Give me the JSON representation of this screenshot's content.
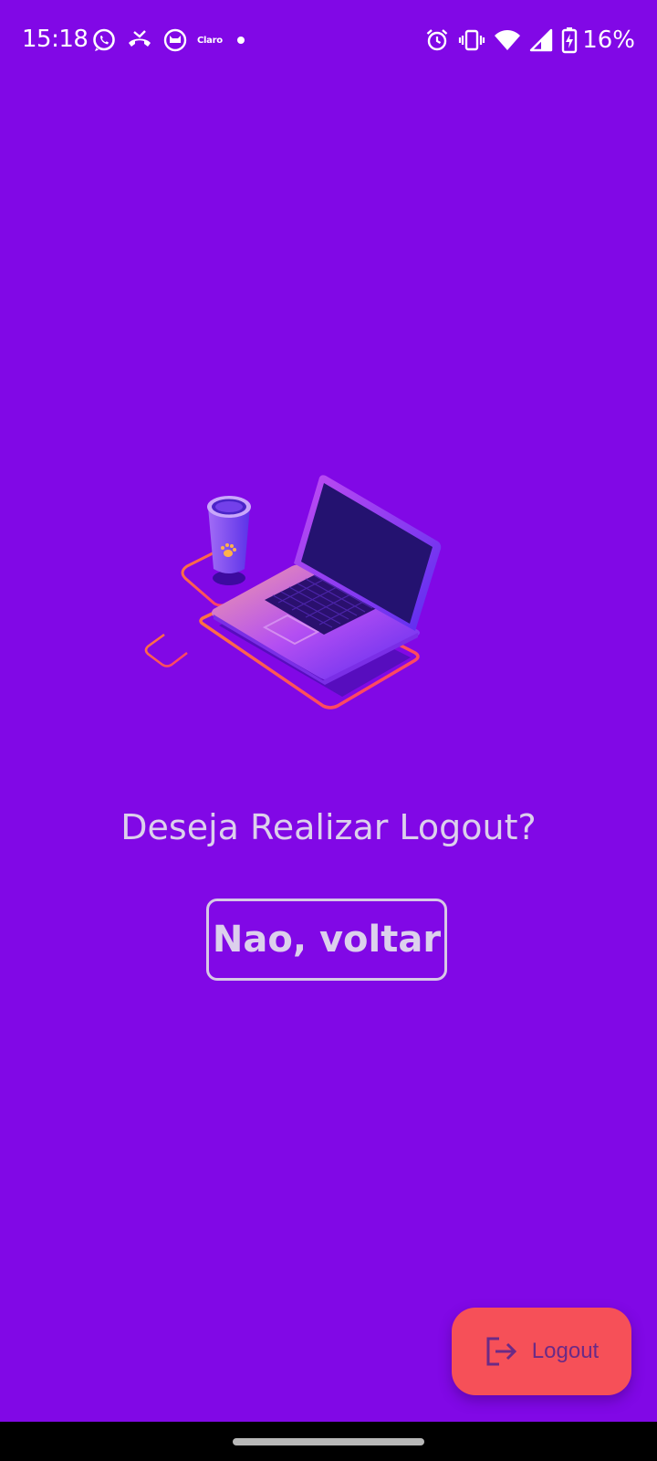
{
  "status_bar": {
    "time": "15:18",
    "carrier": "Claro",
    "battery_percent": "16%",
    "left_icons": [
      "whatsapp-icon",
      "missed-call-icon",
      "cat-app-icon",
      "claro-icon",
      "dot-icon"
    ],
    "right_icons": [
      "alarm-icon",
      "vibrate-icon",
      "wifi-icon",
      "cellular-signal-icon",
      "battery-charging-icon"
    ]
  },
  "illustration": {
    "name": "laptop-and-cup-illustration"
  },
  "dialog": {
    "question": "Deseja Realizar Logout?",
    "back_label": "Nao, voltar"
  },
  "fab": {
    "label": "Logout",
    "icon": "logout-icon"
  },
  "colors": {
    "background": "#8108e6",
    "fab_background": "#f65058",
    "text_light": "#dcd0ec"
  }
}
